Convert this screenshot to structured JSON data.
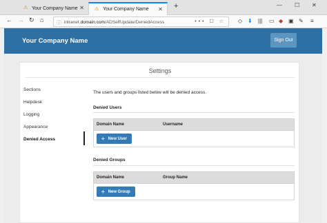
{
  "browser": {
    "tabs": [
      {
        "title": "Your Company Name",
        "active": false
      },
      {
        "title": "Your Company Name",
        "active": true
      }
    ],
    "url_prefix": "intranet.",
    "url_domain": "domain.com",
    "url_path": "/ADSelfUpdate/DeniedAccess",
    "new_tab_glyph": "+",
    "url_icons": "••• ☐ ☆"
  },
  "header": {
    "brand": "Your Company Name",
    "sign_out": "Sign Out"
  },
  "settings": {
    "title": "Settings",
    "nav": [
      "Sections",
      "Helpdesk",
      "Logging",
      "Appearance",
      "Denied Access"
    ],
    "active_nav": "Denied Access",
    "intro": "The users and groups listed below will be denied access.",
    "denied_users": {
      "heading": "Denied Users",
      "columns": [
        "Domain Name",
        "Username"
      ],
      "button": "New User"
    },
    "denied_groups": {
      "heading": "Denied Groups",
      "columns": [
        "Domain Name",
        "Group Name"
      ],
      "button": "New Group"
    }
  },
  "colors": {
    "header": "#2e6fa4",
    "primary_button": "#337ab7",
    "tab_accent": "#0a84ff"
  }
}
